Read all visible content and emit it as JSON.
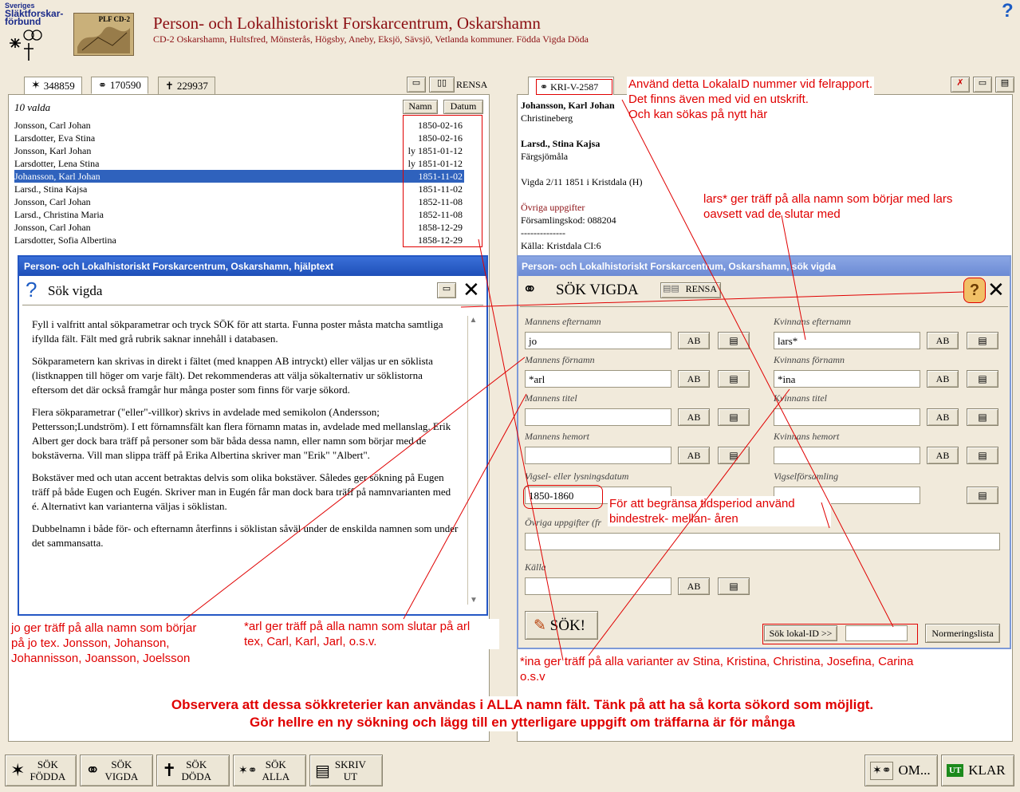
{
  "header": {
    "logo_text_1": "Sveriges",
    "logo_text_2": "Släktforskar-",
    "logo_text_3": "förbund",
    "cd_label": "PLF CD-2",
    "title": "Person- och Lokalhistoriskt Forskarcentrum, Oskarshamn",
    "subtitle": "CD-2 Oskarshamn, Hultsfred, Mönsterås, Högsby, Aneby, Eksjö, Sävsjö, Vetlanda kommuner. Födda Vigda Döda",
    "help_glyph": "?"
  },
  "left_tabs": [
    {
      "icon": "birth-icon",
      "label": "348859"
    },
    {
      "icon": "rings-icon",
      "label": "170590"
    },
    {
      "icon": "cross-icon",
      "label": "229937"
    }
  ],
  "left_toolbar": {
    "clear_label": "RENSA"
  },
  "list": {
    "count_label": "10 valda",
    "col_name": "Namn",
    "col_date": "Datum",
    "rows": [
      {
        "name": "Jonsson, Carl Johan",
        "date": "1850-02-16"
      },
      {
        "name": "Larsdotter, Eva Stina",
        "date": "1850-02-16"
      },
      {
        "name": "Jonsson, Karl Johan",
        "date": "ly 1851-01-12"
      },
      {
        "name": "Larsdotter, Lena Stina",
        "date": "ly 1851-01-12"
      },
      {
        "name": "Johansson, Karl Johan",
        "date": "1851-11-02"
      },
      {
        "name": "Larsd., Stina Kajsa",
        "date": "1851-11-02"
      },
      {
        "name": "Jonsson, Carl Johan",
        "date": "1852-11-08"
      },
      {
        "name": "Larsd., Christina Maria",
        "date": "1852-11-08"
      },
      {
        "name": "Jonsson, Carl Johan",
        "date": "1858-12-29"
      },
      {
        "name": "Larsdotter, Sofia Albertina",
        "date": "1858-12-29"
      }
    ]
  },
  "detail": {
    "local_id": "KRI-V-2587",
    "man_name": "Johansson, Karl Johan",
    "man_place": "Christineberg",
    "woman_name": "Larsd., Stina Kajsa",
    "woman_place": "Färgsjömåla",
    "wedding": "Vigda 2/11 1851 i Kristdala (H)",
    "other_heading": "Övriga uppgifter",
    "parish_code": "Församlingskod: 088204",
    "separator": "--------------",
    "source": "Källa: Kristdala CI:6"
  },
  "help_window": {
    "titlebar": "Person- och Lokalhistoriskt Forskarcentrum, Oskarshamn, hjälptext",
    "heading": "Sök vigda",
    "p1": "Fyll i valfritt antal sökparametrar och tryck SÖK för att starta. Funna poster måsta matcha samtliga ifyllda fält. Fält med grå rubrik saknar innehåll i databasen.",
    "p2": "Sökparametern kan skrivas in direkt i fältet (med knappen AB intryckt) eller väljas ur en söklista (listknappen till höger om varje fält). Det rekommenderas att välja sökalternativ ur söklistorna eftersom det där också framgår hur många poster som finns för varje sökord.",
    "p3": "Flera sökparametrar (\"eller\"-villkor) skrivs in avdelade med semikolon (Andersson; Pettersson;Lundström). I ett förnamnsfält kan flera förnamn matas in, avdelade med mellanslag. Erik Albert ger dock bara träff på personer som bär båda dessa namn, eller namn som börjar med de bokstäverna. Vill man slippa träff på Erika Albertina skriver man \"Erik\" \"Albert\".",
    "p4": "Bokstäver med och utan accent betraktas delvis som olika bokstäver. Således ger sökning på Eugen träff på både Eugen och Eugén. Skriver man in Eugén får man dock bara träff på namnvarianten med é. Alternativt kan varianterna väljas i söklistan.",
    "p5": "Dubbelnamn i både för- och efternamn återfinns i söklistan såväl under de enskilda namnen som under det sammansatta."
  },
  "search_window": {
    "titlebar": "Person- och Lokalhistoriskt Forskarcentrum, Oskarshamn, sök vigda",
    "heading": "SÖK VIGDA",
    "clear_label": "RENSA",
    "help_glyph": "?",
    "ab_label": "AB",
    "fields": {
      "man_lastname": {
        "label": "Mannens efternamn",
        "value": "jo"
      },
      "man_firstname": {
        "label": "Mannens förnamn",
        "value": "*arl"
      },
      "man_title": {
        "label": "Mannens titel",
        "value": ""
      },
      "man_home": {
        "label": "Mannens hemort",
        "value": ""
      },
      "woman_lastname": {
        "label": "Kvinnans efternamn",
        "value": "lars*"
      },
      "woman_firstname": {
        "label": "Kvinnans förnamn",
        "value": "*ina"
      },
      "woman_title": {
        "label": "Kvinnans titel",
        "value": ""
      },
      "woman_home": {
        "label": "Kvinnans hemort",
        "value": ""
      },
      "date": {
        "label": "Vigsel- eller lysningsdatum",
        "value": "1850-1860"
      },
      "parish": {
        "label": "Vigselförsamling",
        "value": ""
      },
      "other": {
        "label": "Övriga uppgifter (fr",
        "value": ""
      },
      "source": {
        "label": "Källa",
        "value": ""
      }
    },
    "search_button": "SÖK!",
    "local_id_button": "Sök lokal-ID >>",
    "normalize_button": "Normeringslista"
  },
  "annotations": {
    "local_id": [
      "Använd detta LokalaID nummer vid felrapport.",
      "Det finns även med vid en utskrift.",
      "Och kan sökas på nytt här"
    ],
    "lars": [
      "lars*  ger träff på alla namn som börjar med   lars",
      "oavsett vad de slutar med"
    ],
    "dates": [
      "För att begränsa tidsperiod använd",
      "bindestrek- mellan- åren"
    ],
    "jo": [
      "jo ger träff på alla namn som börjar",
      "på  jo   tex. Jonsson, Johanson,",
      "Johannisson, Joansson, Joelsson"
    ],
    "arl": [
      "*arl ger träff på alla namn som slutar på arl",
      " tex, Carl, Karl, Jarl, o.s.v."
    ],
    "ina": [
      "*ina  ger träff på alla varianter av Stina, Kristina, Christina, Josefina, Carina",
      "o.s.v"
    ],
    "note": [
      "Observera att dessa sökkreterier kan användas i ALLA namn fält.  Tänk på att ha så korta sökord som möjligt.",
      "Gör hellre en ny sökning och lägg till en ytterligare uppgift om träffarna är för många"
    ]
  },
  "bottom_bar": {
    "btn_born": [
      "SÖK",
      "FÖDDA"
    ],
    "btn_married": [
      "SÖK",
      "VIGDA"
    ],
    "btn_dead": [
      "SÖK",
      "DÖDA"
    ],
    "btn_all": [
      "SÖK",
      "ALLA"
    ],
    "btn_print": [
      "SKRIV",
      "UT"
    ],
    "btn_about": "OM...",
    "btn_done": "KLAR",
    "exit_icon_text": "UT"
  }
}
